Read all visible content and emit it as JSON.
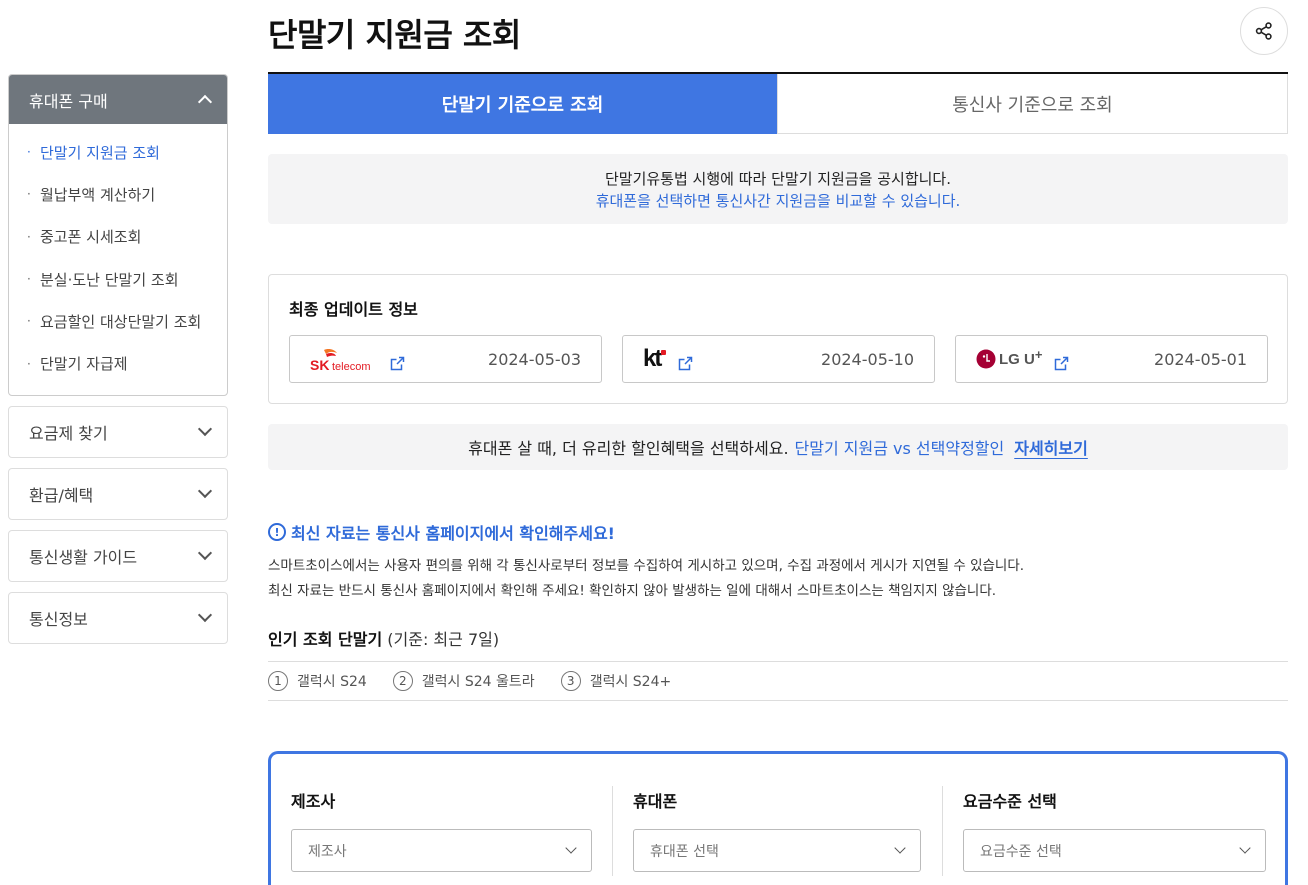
{
  "page": {
    "title": "단말기 지원금 조회"
  },
  "sidebar": {
    "groups": [
      {
        "label": "휴대폰 구매",
        "items": [
          {
            "label": "단말기 지원금 조회"
          },
          {
            "label": "월납부액 계산하기"
          },
          {
            "label": "중고폰 시세조회"
          },
          {
            "label": "분실·도난 단말기 조회"
          },
          {
            "label": "요금할인 대상단말기 조회"
          },
          {
            "label": "단말기 자급제"
          }
        ]
      },
      {
        "label": "요금제 찾기"
      },
      {
        "label": "환급/혜택"
      },
      {
        "label": "통신생활 가이드"
      },
      {
        "label": "통신정보"
      }
    ],
    "bullet": "·"
  },
  "tabs": [
    {
      "label": "단말기 기준으로 조회"
    },
    {
      "label": "통신사 기준으로 조회"
    }
  ],
  "notice": {
    "line1": "단말기유통법 시행에 따라 단말기 지원금을 공시합니다.",
    "line2": "휴대폰을 선택하면 통신사간 지원금을 비교할 수 있습니다."
  },
  "update": {
    "title": "최종 업데이트 정보",
    "carriers": [
      {
        "logo_text": "SK",
        "logo_sub": "telecom",
        "date": "2024-05-03"
      },
      {
        "logo_text": "kt",
        "date": "2024-05-10"
      },
      {
        "logo_text": "LG U",
        "logo_sup": "+",
        "date": "2024-05-01"
      }
    ]
  },
  "promo": {
    "text": "휴대폰 살 때, 더 유리한 할인혜택을 선택하세요.",
    "highlight": "단말기 지원금 vs 선택약정할인",
    "link": "자세히보기"
  },
  "warning": {
    "icon_glyph": "!",
    "title": "최신 자료는 통신사 홈페이지에서 확인해주세요!",
    "line1": "스마트초이스에서는 사용자 편의를 위해 각 통신사로부터 정보를 수집하여 게시하고 있으며, 수집 과정에서 게시가 지연될 수 있습니다.",
    "line2": "최신 자료는 반드시 통신사 홈페이지에서 확인해 주세요! 확인하지 않아 발생하는 일에 대해서 스마트초이스는 책임지지 않습니다."
  },
  "popular": {
    "title": "인기 조회 단말기",
    "note": " (기준: 최근 7일)",
    "items": [
      {
        "num": "1",
        "name": "갤럭시 S24"
      },
      {
        "num": "2",
        "name": "갤럭시 S24 울트라"
      },
      {
        "num": "3",
        "name": "갤럭시 S24+"
      }
    ]
  },
  "filters": [
    {
      "label": "제조사",
      "placeholder": "제조사"
    },
    {
      "label": "휴대폰",
      "placeholder": "휴대폰 선택"
    },
    {
      "label": "요금수준 선택",
      "placeholder": "요금수준 선택"
    }
  ],
  "icons": [
    "chevron-up-icon",
    "chevron-down-icon",
    "share-icon",
    "external-link-icon",
    "info-icon"
  ],
  "colors": {
    "accent": "#3f76e2",
    "link": "#2f6ad9",
    "sidebar_head": "#6f767d"
  }
}
